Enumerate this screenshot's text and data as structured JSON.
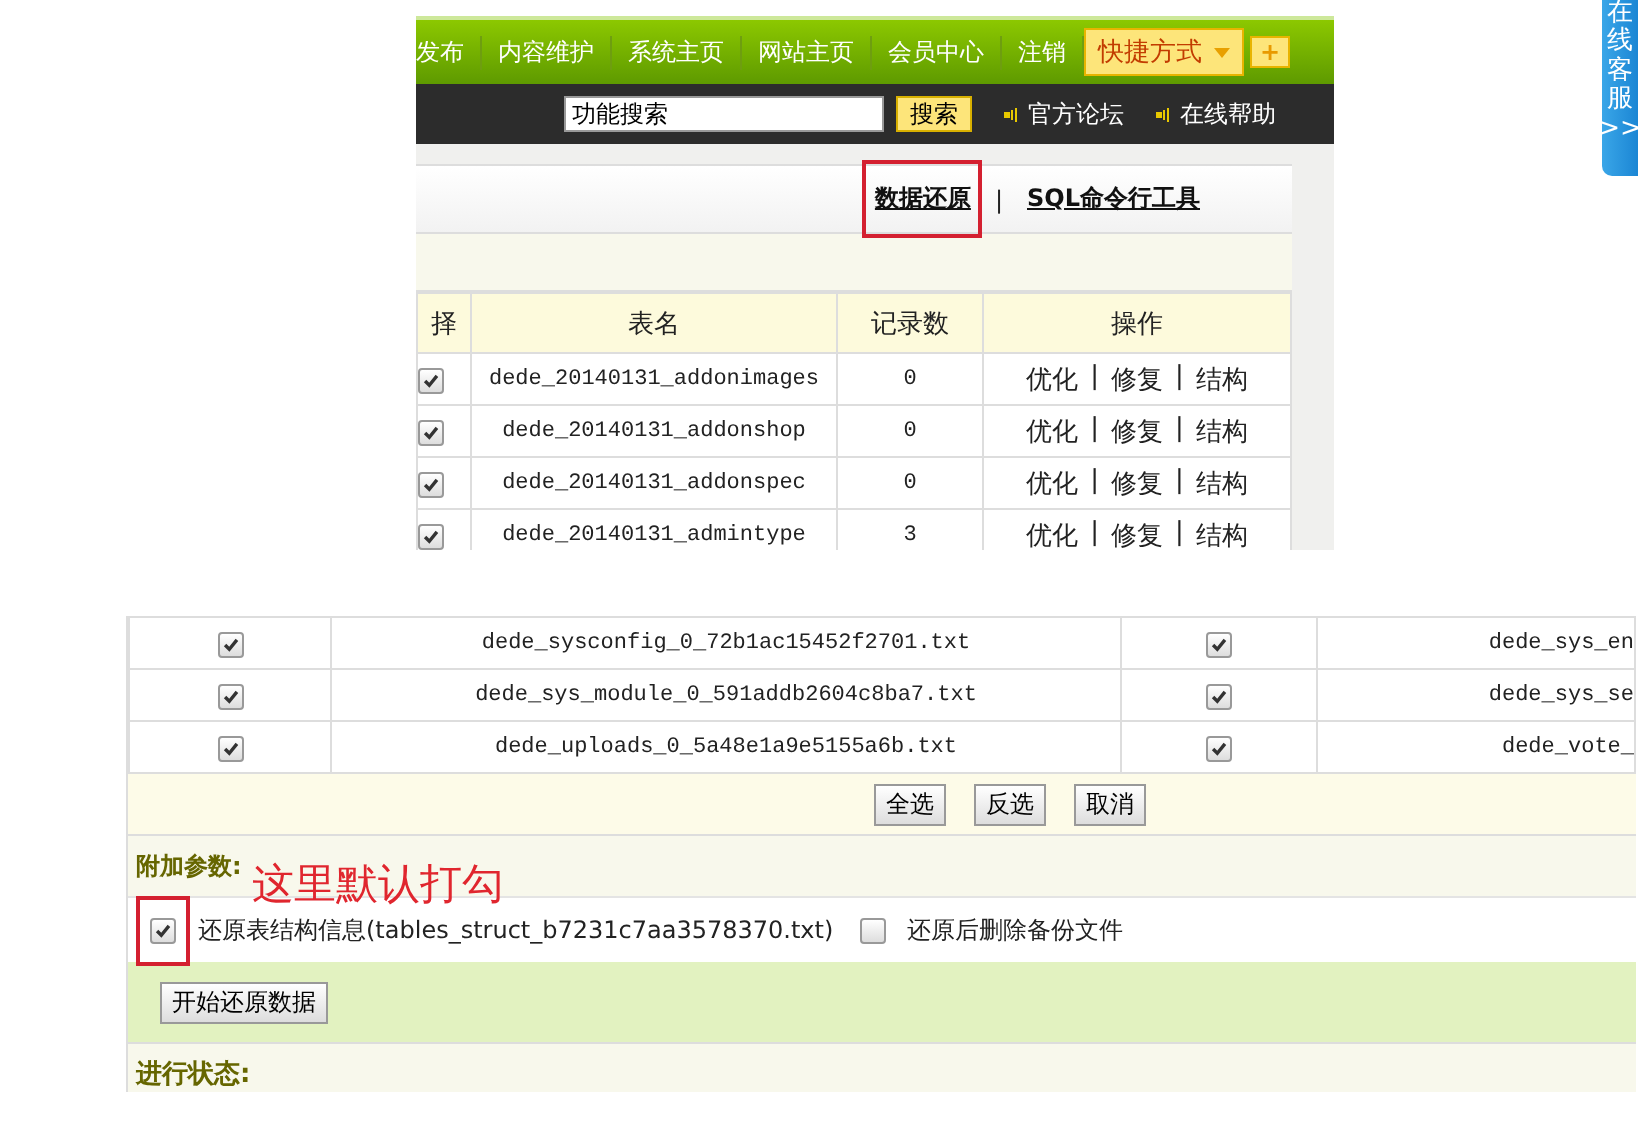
{
  "nav": {
    "items": [
      {
        "label": "发布"
      },
      {
        "label": "内容维护"
      },
      {
        "label": "系统主页"
      },
      {
        "label": "网站主页"
      },
      {
        "label": "会员中心"
      },
      {
        "label": "注销"
      }
    ],
    "shortcut": "快捷方式",
    "plus": "+"
  },
  "toolbar": {
    "search": {
      "value": "功能搜索"
    },
    "search_button": "搜索",
    "links": [
      "官方论坛",
      "在线帮助"
    ]
  },
  "links": [
    {
      "label": "数据还原",
      "highlighted": true
    },
    {
      "label": "SQL命令行工具",
      "highlighted": false
    }
  ],
  "link_separator": "|",
  "table": {
    "columns": [
      "择",
      "表名",
      "记录数",
      "操作"
    ],
    "action_separator": "|",
    "rows": [
      {
        "checked": true,
        "name": "dede_20140131_addonimages",
        "count": "0",
        "actions": [
          "优化",
          "修复",
          "结构"
        ]
      },
      {
        "checked": true,
        "name": "dede_20140131_addonshop",
        "count": "0",
        "actions": [
          "优化",
          "修复",
          "结构"
        ]
      },
      {
        "checked": true,
        "name": "dede_20140131_addonspec",
        "count": "0",
        "actions": [
          "优化",
          "修复",
          "结构"
        ]
      },
      {
        "checked": true,
        "name": "dede_20140131_admintype",
        "count": "3",
        "actions": [
          "优化",
          "修复",
          "结构"
        ]
      }
    ]
  },
  "files": [
    {
      "left": {
        "checked": true,
        "name": "dede_sysconfig_0_72b1ac15452f2701.txt"
      },
      "right": {
        "checked": true,
        "name": "dede_sys_en"
      }
    },
    {
      "left": {
        "checked": true,
        "name": "dede_sys_module_0_591addb2604c8ba7.txt"
      },
      "right": {
        "checked": true,
        "name": "dede_sys_se"
      }
    },
    {
      "left": {
        "checked": true,
        "name": "dede_uploads_0_5a48e1a9e5155a6b.txt"
      },
      "right": {
        "checked": true,
        "name": "dede_vote_"
      }
    }
  ],
  "buttons": [
    "全选",
    "反选",
    "取消"
  ],
  "options": {
    "title": "附加参数:",
    "items": [
      {
        "checked": true,
        "highlighted": true,
        "label": "还原表结构信息(tables_struct_b7231c7aa3578370.txt)"
      },
      {
        "checked": false,
        "highlighted": false,
        "label": "还原后删除备份文件"
      }
    ]
  },
  "start_button": "开始还原数据",
  "status_label": "进行状态:",
  "annotation": "这里默认打勾",
  "side_tab": {
    "label": "在线客服",
    "arrow": ">>"
  }
}
